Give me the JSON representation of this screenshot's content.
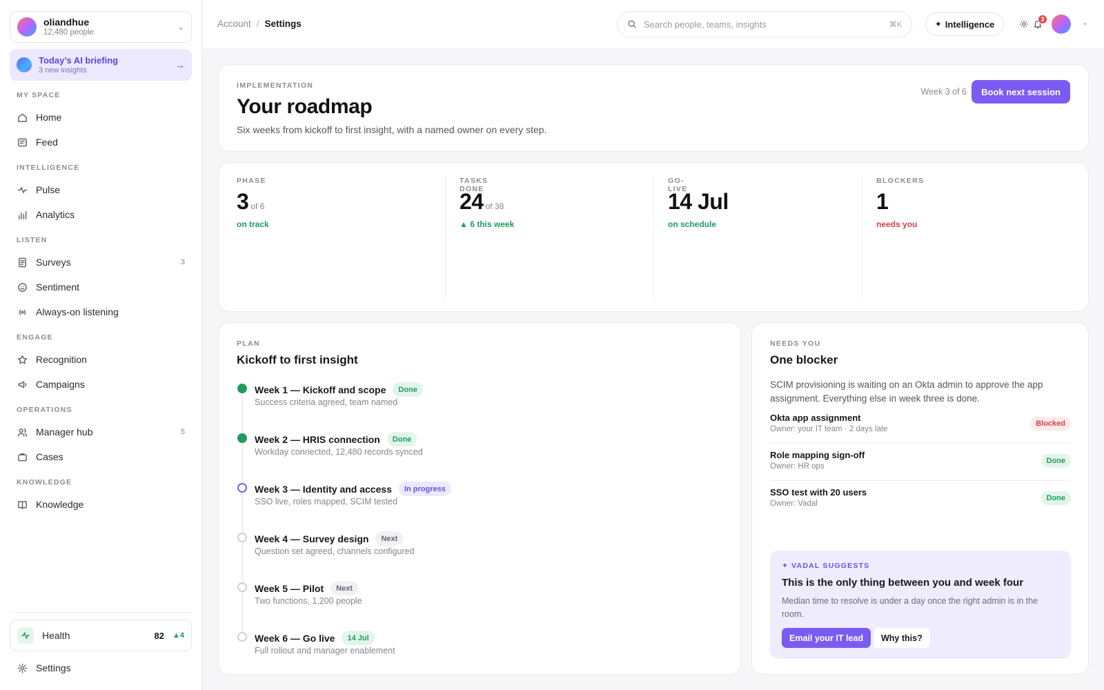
{
  "org": {
    "name": "oliandhue",
    "sub": "12,480 people"
  },
  "briefing": {
    "title": "Today’s AI briefing",
    "sub": "3 new insights"
  },
  "sections": {
    "my_space": "MY SPACE",
    "intelligence": "INTELLIGENCE",
    "listen": "LISTEN",
    "engage": "ENGAGE",
    "operations": "OPERATIONS",
    "knowledge": "KNOWLEDGE"
  },
  "nav": {
    "home": "Home",
    "feed": "Feed",
    "pulse": "Pulse",
    "analytics": "Analytics",
    "surveys": "Surveys",
    "surveys_count": "3",
    "sentiment": "Sentiment",
    "listening": "Always-on listening",
    "recognition": "Recognition",
    "campaigns": "Campaigns",
    "manager_hub": "Manager hub",
    "manager_hub_count": "5",
    "cases": "Cases",
    "knowledge": "Knowledge",
    "settings": "Settings"
  },
  "health": {
    "label": "Health",
    "score": "82",
    "delta": "▲4"
  },
  "breadcrumb": {
    "parent": "Account",
    "separator": "/",
    "current": "Settings"
  },
  "search": {
    "placeholder": "Search people, teams, insights",
    "shortcut": "⌘K"
  },
  "topbar": {
    "intelligence_label": "Intelligence",
    "notifications_count": "3"
  },
  "hero": {
    "eyebrow": "IMPLEMENTATION",
    "title": "Your roadmap",
    "subtitle": "Six weeks from kickoff to first insight, with a named owner on every step.",
    "week": "Week 3 of 6",
    "button": "Book next session"
  },
  "stats": [
    {
      "label": "PHASE",
      "value": "3",
      "of": "of 6",
      "note": "on track"
    },
    {
      "label": "TASKS DONE",
      "value": "24",
      "of": "of 38",
      "note": "▲ 6 this week"
    },
    {
      "label": "GO-LIVE",
      "value": "14 Jul",
      "of": "",
      "note": "on schedule"
    },
    {
      "label": "BLOCKERS",
      "value": "1",
      "of": "",
      "note": "needs you"
    }
  ],
  "plan": {
    "eyebrow": "PLAN",
    "title": "Kickoff to first insight",
    "steps": [
      {
        "title": "Week 1 — Kickoff and scope",
        "badge": "Done",
        "sub": "Success criteria agreed, team named"
      },
      {
        "title": "Week 2 — HRIS connection",
        "badge": "Done",
        "sub": "Workday connected, 12,480 records synced"
      },
      {
        "title": "Week 3 — Identity and access",
        "badge": "In progress",
        "sub": "SSO live, roles mapped, SCIM tested"
      },
      {
        "title": "Week 4 — Survey design",
        "badge": "Next",
        "sub": "Question set agreed, channels configured"
      },
      {
        "title": "Week 5 — Pilot",
        "badge": "Next",
        "sub": "Two functions, 1,200 people"
      },
      {
        "title": "Week 6 — Go live",
        "badge": "14 Jul",
        "sub": "Full rollout and manager enablement"
      }
    ]
  },
  "needs": {
    "eyebrow": "NEEDS YOU",
    "title": "One blocker",
    "description": "SCIM provisioning is waiting on an Okta admin to approve the app assignment. Everything else in week three is done.",
    "tasks": [
      {
        "title": "Okta app assignment",
        "owner": "Owner: your IT team · 2 days late",
        "status": "Blocked"
      },
      {
        "title": "Role mapping sign-off",
        "owner": "Owner: HR ops",
        "status": "Done"
      },
      {
        "title": "SSO test with 20 users",
        "owner": "Owner: Vadal",
        "status": "Done"
      }
    ]
  },
  "suggest": {
    "eyebrow": "✦ VADAL SUGGESTS",
    "title": "This is the only thing between you and week four",
    "body": "Median time to resolve is under a day once the right admin is in the room.",
    "primary": "Email your IT lead",
    "secondary": "Why this?"
  }
}
